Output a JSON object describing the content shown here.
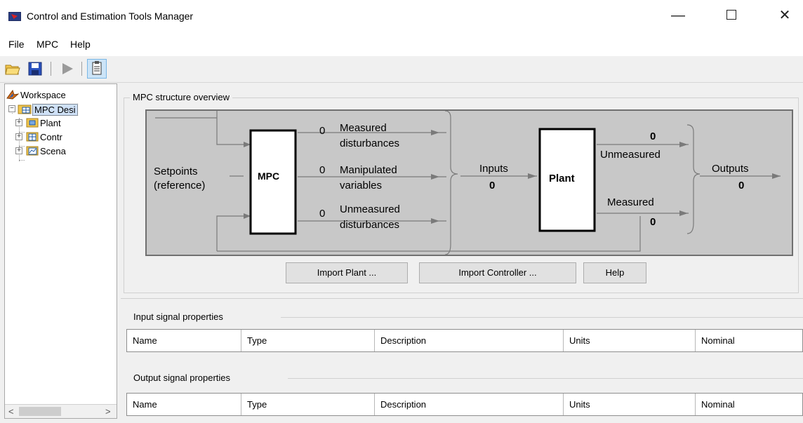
{
  "window": {
    "title": "Control and Estimation Tools Manager",
    "minimize_glyph": "—",
    "close_glyph": "✕"
  },
  "menu": {
    "items": [
      {
        "label": "File"
      },
      {
        "label": "MPC"
      },
      {
        "label": "Help"
      }
    ]
  },
  "toolbar": {
    "buttons": [
      "open-folder-icon",
      "save-icon",
      "run-icon",
      "clipboard-icon"
    ]
  },
  "tree": {
    "items": [
      {
        "label": "Workspace",
        "icon": "workspace-icon"
      },
      {
        "label": "MPC Desi",
        "icon": "mpc-design-icon"
      },
      {
        "label": "Plant",
        "icon": "plant-models-icon"
      },
      {
        "label": "Contr",
        "icon": "controllers-icon"
      },
      {
        "label": "Scena",
        "icon": "scenarios-icon"
      }
    ],
    "scroll_left": "<",
    "scroll_right": ">"
  },
  "overview": {
    "title": "MPC structure overview",
    "diagram": {
      "setpoints_line1": "Setpoints",
      "setpoints_line2": "(reference)",
      "mpc_label": "MPC",
      "md_count": "0",
      "md_line1": "Measured",
      "md_line2": "disturbances",
      "mv_count": "0",
      "mv_line1": "Manipulated",
      "mv_line2": "variables",
      "ud_count": "0",
      "ud_line1": "Unmeasured",
      "ud_line2": "disturbances",
      "inputs_label": "Inputs",
      "inputs_count": "0",
      "plant_label": "Plant",
      "unmeasured_count": "0",
      "unmeasured_label": "Unmeasured",
      "measured_label": "Measured",
      "measured_count": "0",
      "outputs_label": "Outputs",
      "outputs_count": "0"
    },
    "buttons": {
      "import_plant": "Import Plant ...",
      "import_controller": "Import Controller ...",
      "help": "Help"
    }
  },
  "input_signals": {
    "title": "Input signal properties",
    "columns": [
      "Name",
      "Type",
      "Description",
      "Units",
      "Nominal"
    ]
  },
  "output_signals": {
    "title": "Output signal properties",
    "columns": [
      "Name",
      "Type",
      "Description",
      "Units",
      "Nominal"
    ]
  }
}
